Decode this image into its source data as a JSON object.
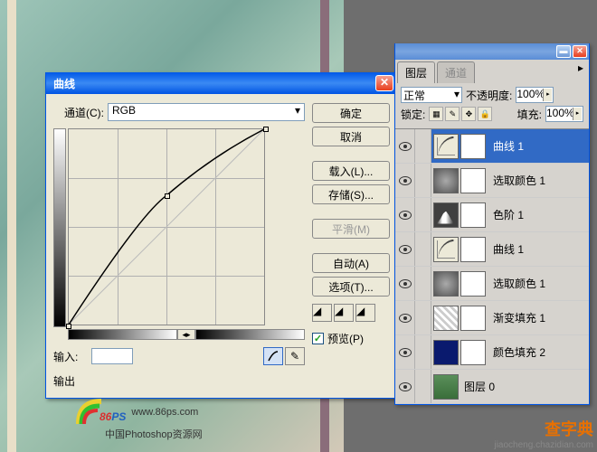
{
  "curves_dialog": {
    "title": "曲线",
    "channel_label": "通道(C):",
    "channel_value": "RGB",
    "input_label": "输入:",
    "output_label": "输出",
    "buttons": {
      "ok": "确定",
      "cancel": "取消",
      "load": "载入(L)...",
      "save": "存储(S)...",
      "smooth": "平滑(M)",
      "auto": "自动(A)",
      "options": "选项(T)..."
    },
    "preview_label": "预览(P)",
    "preview_checked": true
  },
  "layers_panel": {
    "tabs": {
      "layers": "图层",
      "channels": "通道"
    },
    "blend_mode": "正常",
    "opacity_label": "不透明度:",
    "opacity_value": "100%",
    "lock_label": "锁定:",
    "fill_label": "填充:",
    "fill_value": "100%",
    "layers": [
      {
        "name": "曲线 1",
        "type": "curves",
        "selected": true
      },
      {
        "name": "选取颜色 1",
        "type": "sel-color",
        "selected": false
      },
      {
        "name": "色阶 1",
        "type": "levels",
        "selected": false
      },
      {
        "name": "曲线 1",
        "type": "curves",
        "selected": false
      },
      {
        "name": "选取颜色 1",
        "type": "sel-color",
        "selected": false
      },
      {
        "name": "渐变填充 1",
        "type": "gradient",
        "selected": false
      },
      {
        "name": "颜色填充 2",
        "type": "solid",
        "selected": false
      },
      {
        "name": "图层 0",
        "type": "img",
        "selected": false
      }
    ]
  },
  "watermark": {
    "logo1": "86",
    "logo2": "PS",
    "url": "www.86ps.com",
    "subtitle": "中国Photoshop资源网",
    "site_name": "查字典",
    "site_url": "jiaocheng.chazidian.com"
  },
  "chart_data": {
    "type": "line",
    "title": "曲线",
    "xlabel": "输入",
    "ylabel": "输出",
    "xlim": [
      0,
      255
    ],
    "ylim": [
      0,
      255
    ],
    "series": [
      {
        "name": "RGB",
        "points": [
          {
            "x": 0,
            "y": 0
          },
          {
            "x": 128,
            "y": 168
          },
          {
            "x": 255,
            "y": 255
          }
        ]
      }
    ]
  }
}
